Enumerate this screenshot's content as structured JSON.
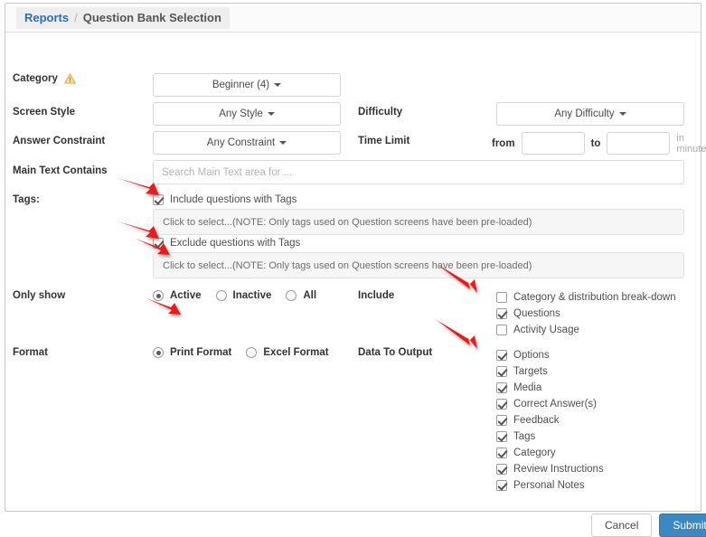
{
  "breadcrumb": {
    "root": "Reports",
    "separator": "/",
    "current": "Question Bank Selection"
  },
  "form": {
    "category": {
      "label": "Category",
      "icon": "warning-triangle-icon",
      "value": "Beginner (4)"
    },
    "screen_style": {
      "label": "Screen Style",
      "value": "Any Style"
    },
    "difficulty": {
      "label": "Difficulty",
      "value": "Any Difficulty"
    },
    "answer_constraint": {
      "label": "Answer Constraint",
      "value": "Any Constraint"
    },
    "time_limit": {
      "label": "Time Limit",
      "from_label": "from",
      "from_value": "",
      "to_label": "to",
      "to_value": "",
      "unit_label": "in minutes"
    },
    "main_text": {
      "label": "Main Text Contains",
      "placeholder": "Search Main Text area for ...",
      "value": ""
    },
    "tags": {
      "label": "Tags:",
      "include": {
        "label": "Include questions with Tags",
        "checked": true,
        "box_text": "Click to select...(NOTE: Only tags used on Question screens have been pre-loaded)"
      },
      "exclude": {
        "label": "Exclude questions with Tags",
        "checked": true,
        "box_text": "Click to select...(NOTE: Only tags used on Question screens have been pre-loaded)"
      }
    },
    "only_show": {
      "label": "Only show",
      "options": [
        {
          "label": "Active",
          "selected": true
        },
        {
          "label": "Inactive",
          "selected": false
        },
        {
          "label": "All",
          "selected": false
        }
      ]
    },
    "include": {
      "label": "Include",
      "options": [
        {
          "label": "Category & distribution break-down",
          "checked": false
        },
        {
          "label": "Questions",
          "checked": true
        },
        {
          "label": "Activity Usage",
          "checked": false
        }
      ]
    },
    "format": {
      "label": "Format",
      "options": [
        {
          "label": "Print Format",
          "selected": true
        },
        {
          "label": "Excel Format",
          "selected": false
        }
      ]
    },
    "data_to_output": {
      "label": "Data To Output",
      "options": [
        {
          "label": "Options",
          "checked": true
        },
        {
          "label": "Targets",
          "checked": true
        },
        {
          "label": "Media",
          "checked": true
        },
        {
          "label": "Correct Answer(s)",
          "checked": true
        },
        {
          "label": "Feedback",
          "checked": true
        },
        {
          "label": "Tags",
          "checked": true
        },
        {
          "label": "Category",
          "checked": true
        },
        {
          "label": "Review Instructions",
          "checked": true
        },
        {
          "label": "Personal Notes",
          "checked": true
        }
      ]
    }
  },
  "footer": {
    "cancel": "Cancel",
    "submit": "Submit"
  },
  "colors": {
    "link": "#2a6ebb",
    "submit": "#3c88c0",
    "warning": "#f0ad4e",
    "annotation_arrow": "#e81e1e"
  }
}
